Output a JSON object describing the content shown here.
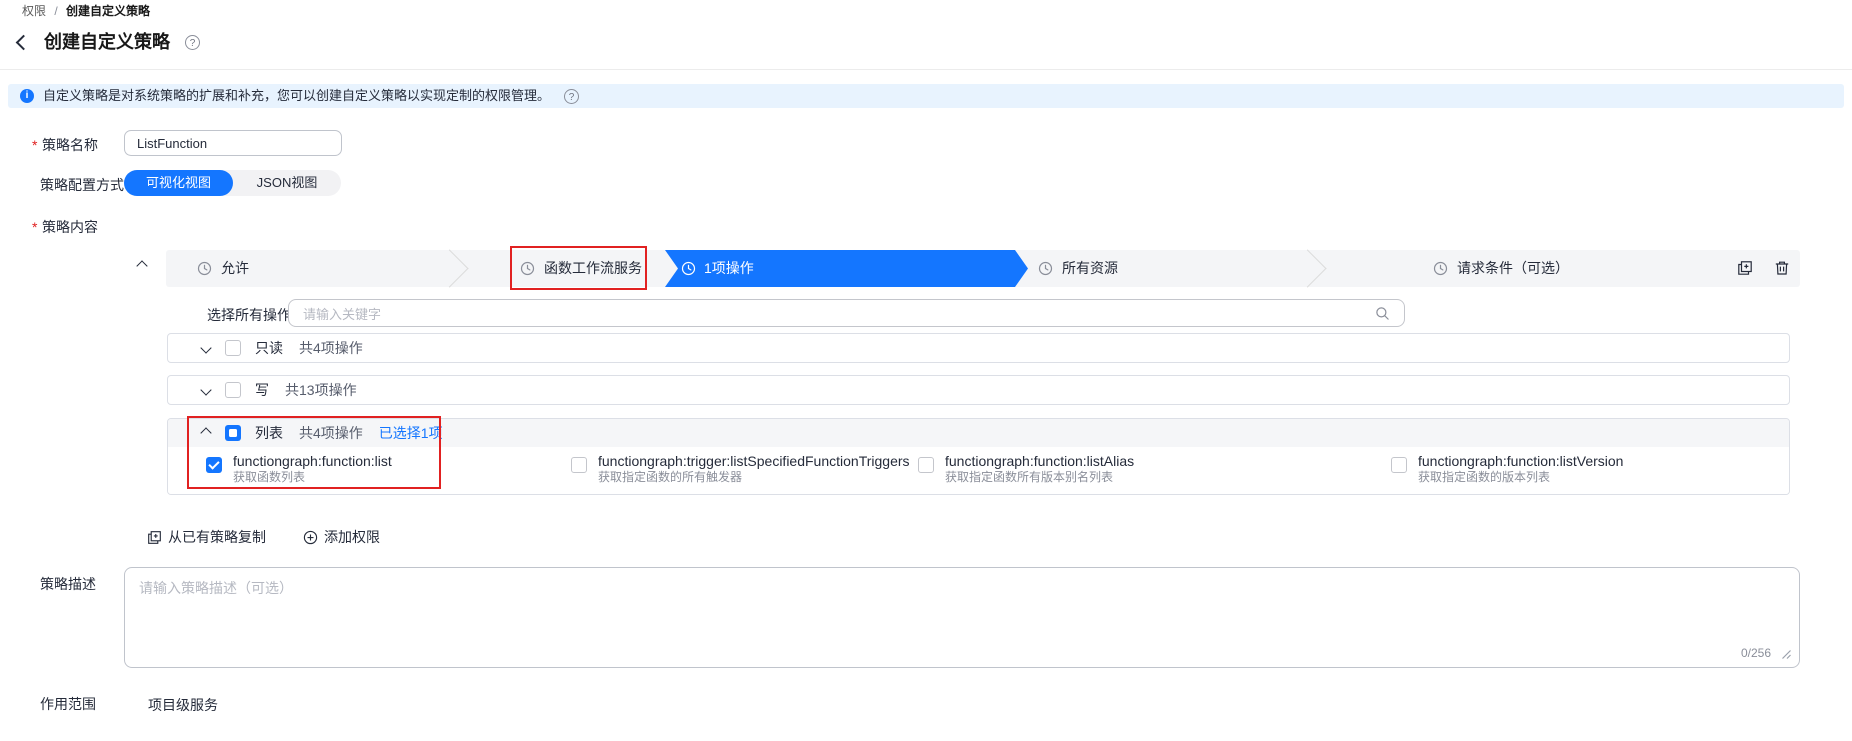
{
  "icons": {
    "help_glyph": "?",
    "info_glyph": "i",
    "required_marker": "*"
  },
  "breadcrumb": {
    "parent": "权限",
    "separator": "/",
    "current": "创建自定义策略"
  },
  "page_header": {
    "title": "创建自定义策略"
  },
  "banner": {
    "message": "自定义策略是对系统策略的扩展和补充，您可以创建自定义策略以实现定制的权限管理。"
  },
  "form": {
    "policy_name": {
      "label": "策略名称",
      "value": "ListFunction"
    },
    "config_mode": {
      "label": "策略配置方式",
      "visual_tab": "可视化视图",
      "json_tab": "JSON视图",
      "active_tab": "可视化视图"
    },
    "policy_content": {
      "label": "策略内容",
      "steps": [
        {
          "label": "允许",
          "state": "default"
        },
        {
          "label": "函数工作流服务",
          "state": "default",
          "highlighted": true
        },
        {
          "label": "1项操作",
          "state": "active"
        },
        {
          "label": "所有资源",
          "state": "default"
        },
        {
          "label": "请求条件（可选）",
          "state": "default"
        }
      ],
      "select_all_label": "选择所有操作",
      "search_placeholder": "请输入关键字",
      "groups": [
        {
          "label": "只读",
          "count": "共4项操作",
          "expanded": false,
          "checked": false
        },
        {
          "label": "写",
          "count": "共13项操作",
          "expanded": false,
          "checked": false
        },
        {
          "label": "列表",
          "count": "共4项操作",
          "selected_badge": "已选择1项",
          "expanded": true,
          "checked": "indeterminate",
          "items": [
            {
              "name": "functiongraph:function:list",
              "desc": "获取函数列表",
              "checked": true
            },
            {
              "name": "functiongraph:trigger:listSpecifiedFunctionTriggers",
              "desc": "获取指定函数的所有触发器",
              "checked": false
            },
            {
              "name": "functiongraph:function:listAlias",
              "desc": "获取指定函数所有版本别名列表",
              "checked": false
            },
            {
              "name": "functiongraph:function:listVersion",
              "desc": "获取指定函数的版本列表",
              "checked": false
            }
          ]
        }
      ],
      "copy_from_existing": "从已有策略复制",
      "add_permission": "添加权限"
    },
    "description": {
      "label": "策略描述",
      "placeholder": "请输入策略描述（可选）",
      "counter": "0/256"
    },
    "scope": {
      "label": "作用范围",
      "value": "项目级服务"
    }
  },
  "colors": {
    "accent_blue": "#1476ff",
    "highlight_red": "#e12121",
    "banner_bg": "#e8f3fe"
  }
}
